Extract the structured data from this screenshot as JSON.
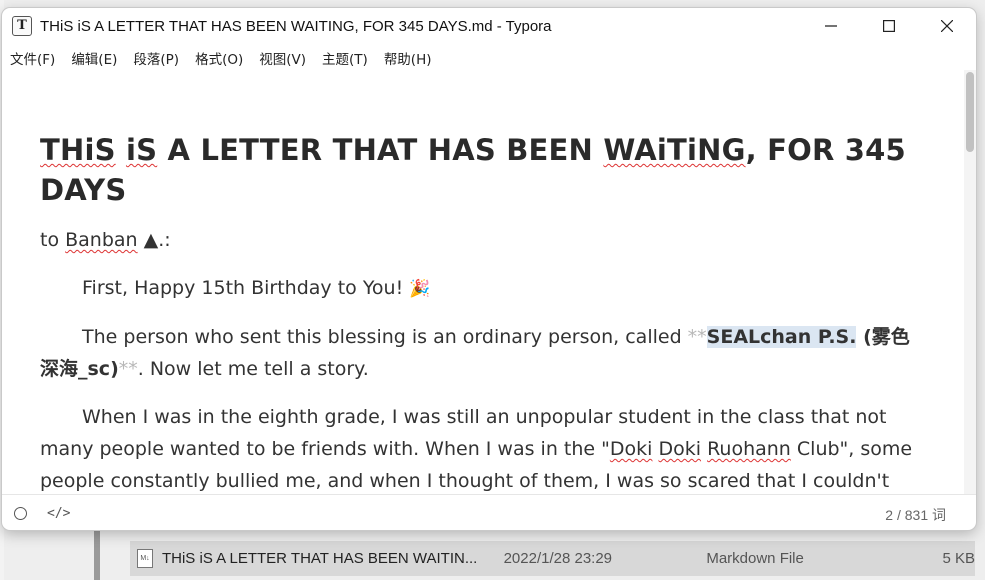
{
  "window": {
    "title": "THiS iS A LETTER THAT HAS BEEN WAITING, FOR 345 DAYS.md - Typora",
    "app_icon": "T",
    "controls": {
      "minimize": "—",
      "maximize": "☐",
      "close": "✕"
    }
  },
  "menubar": {
    "items": [
      "文件(F)",
      "编辑(E)",
      "段落(P)",
      "格式(O)",
      "视图(V)",
      "主题(T)",
      "帮助(H)"
    ]
  },
  "document": {
    "heading": {
      "part1": "THiS",
      "sp1": " ",
      "part2": "iS",
      "part3": " A LETTER THAT HAS BEEN ",
      "part4": "WAiTiNG",
      "part5": ", FOR 345 DAYS"
    },
    "to_line": {
      "prefix": "to ",
      "name": "Banban",
      "suffix": " ▲.:"
    },
    "para1": {
      "text": "First, Happy 15th Birthday to You! ",
      "emoji": "🎉"
    },
    "para2": {
      "pre": "The person who sent this blessing is an ordinary person, called ",
      "mark_open": "**",
      "bold_selected": "SEALchan P.S.",
      "bold_rest": " (雾色深海_sc)",
      "mark_close": "**",
      "post": ". Now let me tell a story."
    },
    "para3": {
      "t1": "When I was in the eighth grade, I was still an unpopular student in the class that not many people wanted to be friends with. When I was in the \"",
      "w1": "Doki",
      "s1": " ",
      "w2": "Doki",
      "s2": " ",
      "w3": "Ruohann",
      "t2": " Club\", some people constantly bullied me, and when I thought of them, I was so scared that I couldn't sleep. In those days, they created a lot of rumors. They treated the people around me and me with"
    }
  },
  "statusbar": {
    "word_count": "2 / 831 词",
    "code_toggle": "</>"
  },
  "background_file_row": {
    "icon_label": "M↓",
    "name": "THiS iS A LETTER THAT HAS BEEN WAITIN...",
    "date": "2022/1/28 23:29",
    "type": "Markdown File",
    "size": "5 KB"
  }
}
